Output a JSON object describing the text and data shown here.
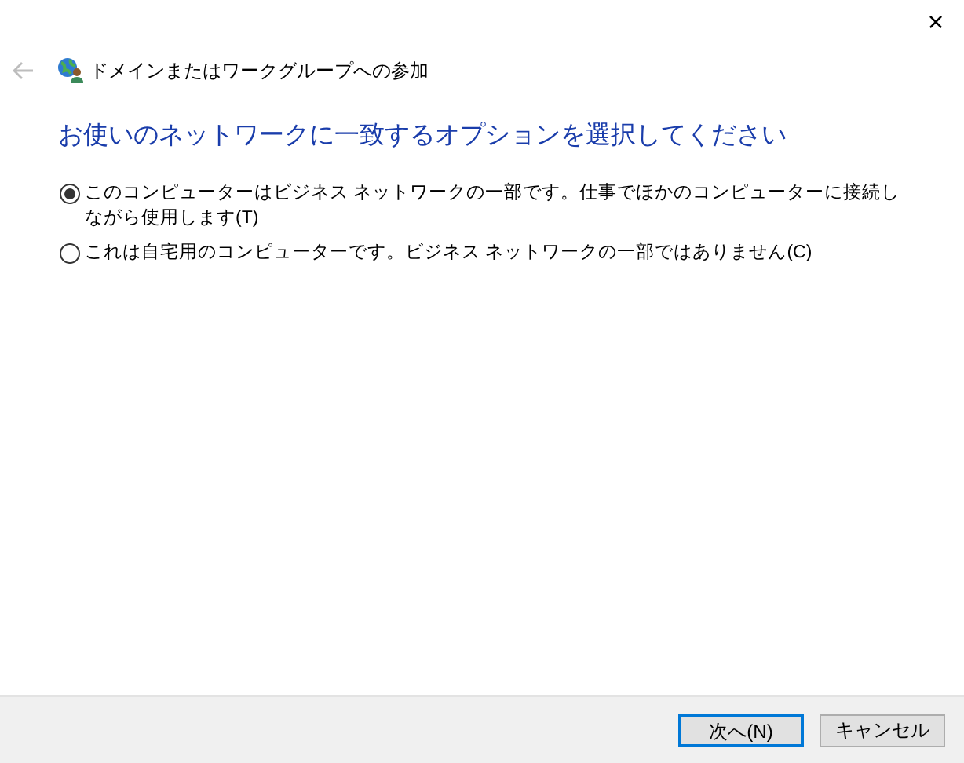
{
  "window": {
    "title": "ドメインまたはワークグループへの参加",
    "close": "×"
  },
  "heading": "お使いのネットワークに一致するオプションを選択してください",
  "options": [
    {
      "label": "このコンピューターはビジネス ネットワークの一部です。仕事でほかのコンピューターに接続しながら使用します(T)",
      "selected": true
    },
    {
      "label": "これは自宅用のコンピューターです。ビジネス ネットワークの一部ではありません(C)",
      "selected": false
    }
  ],
  "buttons": [
    {
      "label": "次へ(N)",
      "default": true
    },
    {
      "label": "キャンセル",
      "default": false
    }
  ]
}
